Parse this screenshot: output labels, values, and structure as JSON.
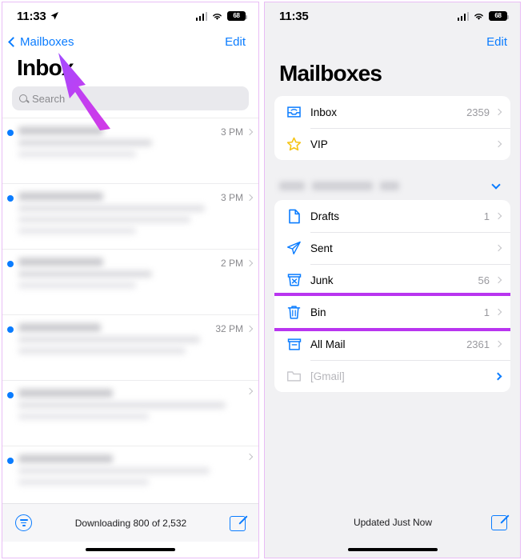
{
  "meta": {
    "accent_blue": "#0a7cff",
    "highlight_purple": "#b935f0",
    "star_yellow": "#f5c518"
  },
  "left_panel": {
    "status_bar": {
      "time": "11:33",
      "location_icon": "location-arrow-icon",
      "cellular_icon": "cellular-bars-icon",
      "wifi_icon": "wifi-icon",
      "battery_level": "68"
    },
    "nav": {
      "back_label": "Mailboxes",
      "back_icon": "chevron-left-icon",
      "edit_label": "Edit"
    },
    "title": "Inbox",
    "search": {
      "placeholder": "Search",
      "icon": "search-icon"
    },
    "messages": [
      {
        "unread": true,
        "time": "3 PM"
      },
      {
        "unread": true,
        "time": "3 PM"
      },
      {
        "unread": true,
        "time": "2 PM"
      },
      {
        "unread": true,
        "time": "32 PM"
      },
      {
        "unread": true,
        "time": ""
      },
      {
        "unread": true,
        "time": ""
      }
    ],
    "footer": {
      "filter_icon": "filter-icon",
      "status": "Downloading 800 of 2,532",
      "compose_icon": "compose-icon"
    }
  },
  "right_panel": {
    "status_bar": {
      "time": "11:35",
      "cellular_icon": "cellular-bars-icon",
      "wifi_icon": "wifi-icon",
      "battery_level": "68"
    },
    "nav": {
      "edit_label": "Edit"
    },
    "title": "Mailboxes",
    "favorites": [
      {
        "icon": "inbox-tray-icon",
        "label": "Inbox",
        "count": "2359"
      },
      {
        "icon": "star-icon",
        "label": "VIP",
        "count": ""
      }
    ],
    "account": {
      "name_hidden": true,
      "chevron_icon": "chevron-down-icon"
    },
    "mailboxes": [
      {
        "icon": "drafts-document-icon",
        "label": "Drafts",
        "count": "1",
        "highlighted": false,
        "dim": false
      },
      {
        "icon": "sent-paperplane-icon",
        "label": "Sent",
        "count": "",
        "highlighted": false,
        "dim": false
      },
      {
        "icon": "junk-box-x-icon",
        "label": "Junk",
        "count": "56",
        "highlighted": false,
        "dim": false
      },
      {
        "icon": "trash-bin-icon",
        "label": "Bin",
        "count": "1",
        "highlighted": true,
        "dim": false
      },
      {
        "icon": "archive-box-icon",
        "label": "All Mail",
        "count": "2361",
        "highlighted": false,
        "dim": false
      },
      {
        "icon": "folder-icon",
        "label": "[Gmail]",
        "count": "",
        "highlighted": false,
        "dim": true
      }
    ],
    "footer": {
      "status": "Updated Just Now",
      "compose_icon": "compose-icon"
    }
  },
  "annotation": {
    "arrow_icon": "pointer-arrow-annotation",
    "arrow_color": "#b935f0",
    "points_to": "Mailboxes"
  }
}
